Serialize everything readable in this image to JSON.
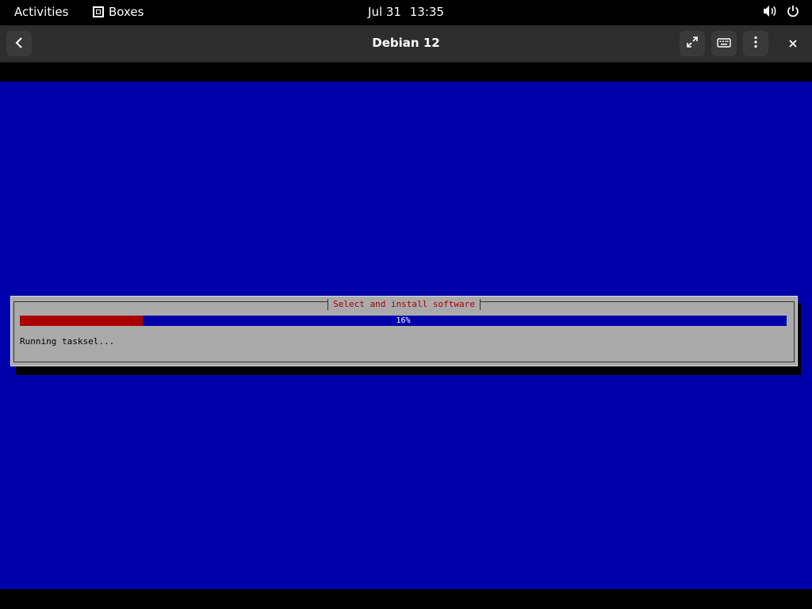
{
  "topbar": {
    "activities": "Activities",
    "app_name": "Boxes",
    "app_icon": "boxes-icon",
    "date": "Jul 31",
    "time": "13:35",
    "volume_icon": "volume-icon",
    "power_icon": "power-icon"
  },
  "headerbar": {
    "title": "Debian 12",
    "back_icon": "back-chevron-icon",
    "fullscreen_icon": "fullscreen-icon",
    "keyboard_icon": "keyboard-icon",
    "menu_icon": "kebab-menu-icon",
    "close_icon": "close-icon"
  },
  "installer": {
    "dialog_title": "Select and install software",
    "progress_percent": 16,
    "progress_label": "16%",
    "status": "Running tasksel...",
    "colors": {
      "background": "#0000aa",
      "dialog": "#aaaaaa",
      "progress_fill": "#aa0000",
      "title_text": "#aa0000"
    }
  }
}
